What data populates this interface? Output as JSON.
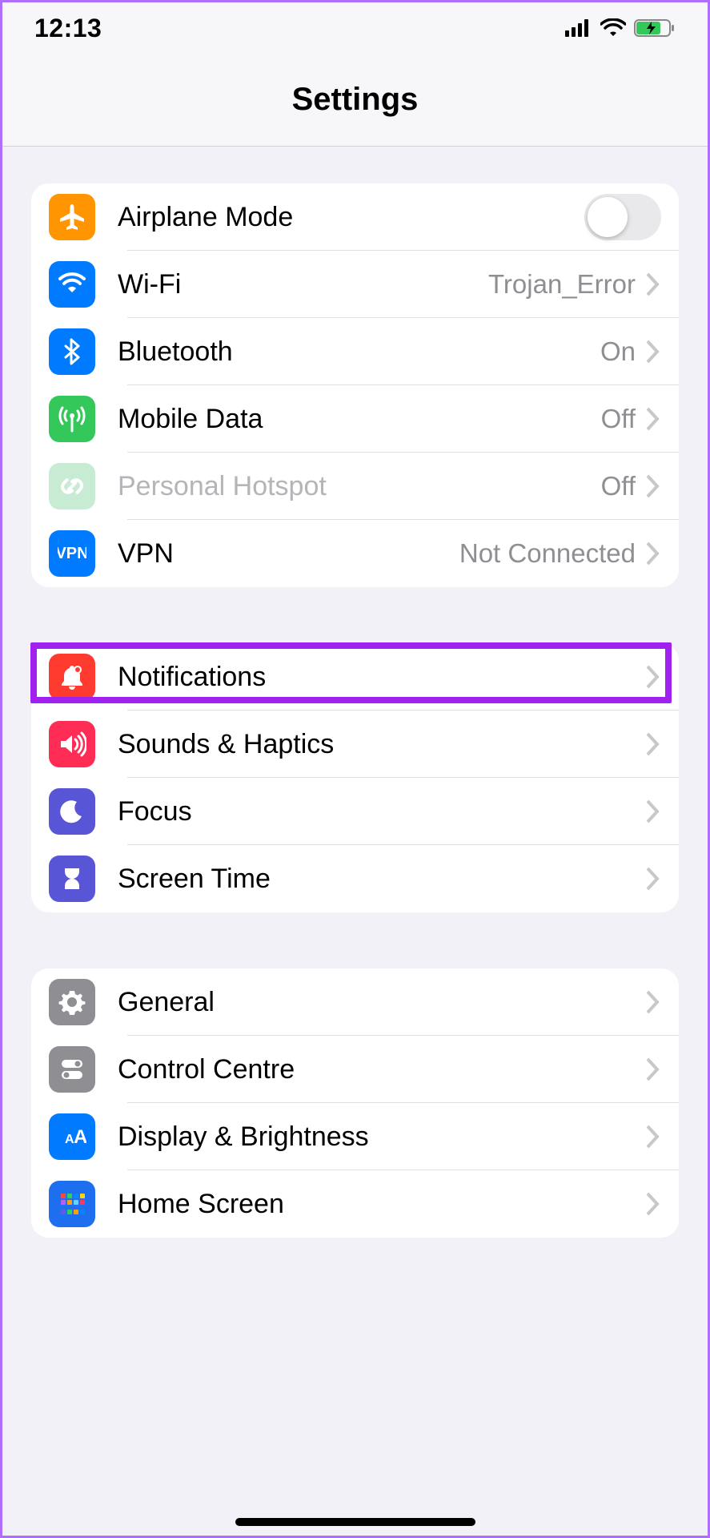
{
  "status": {
    "time": "12:13"
  },
  "header": {
    "title": "Settings"
  },
  "groups": [
    {
      "rows": [
        {
          "id": "airplane",
          "label": "Airplane Mode",
          "value": "",
          "kind": "toggle",
          "toggle_on": false,
          "icon": "airplane-icon",
          "icon_bg": "bg-orange"
        },
        {
          "id": "wifi",
          "label": "Wi-Fi",
          "value": "Trojan_Error",
          "kind": "link",
          "icon": "wifi-icon",
          "icon_bg": "bg-blue"
        },
        {
          "id": "bluetooth",
          "label": "Bluetooth",
          "value": "On",
          "kind": "link",
          "icon": "bluetooth-icon",
          "icon_bg": "bg-blue"
        },
        {
          "id": "mobile",
          "label": "Mobile Data",
          "value": "Off",
          "kind": "link",
          "icon": "antenna-icon",
          "icon_bg": "bg-green"
        },
        {
          "id": "hotspot",
          "label": "Personal Hotspot",
          "value": "Off",
          "kind": "link",
          "icon": "link-icon",
          "icon_bg": "bg-lgreen",
          "disabled": true
        },
        {
          "id": "vpn",
          "label": "VPN",
          "value": "Not Connected",
          "kind": "link",
          "icon": "vpn-icon",
          "icon_bg": "bg-blue"
        }
      ]
    },
    {
      "rows": [
        {
          "id": "notifications",
          "label": "Notifications",
          "value": "",
          "kind": "link",
          "icon": "bell-icon",
          "icon_bg": "bg-red",
          "highlighted": true
        },
        {
          "id": "sounds",
          "label": "Sounds & Haptics",
          "value": "",
          "kind": "link",
          "icon": "speaker-icon",
          "icon_bg": "bg-pink"
        },
        {
          "id": "focus",
          "label": "Focus",
          "value": "",
          "kind": "link",
          "icon": "moon-icon",
          "icon_bg": "bg-indigo"
        },
        {
          "id": "screentime",
          "label": "Screen Time",
          "value": "",
          "kind": "link",
          "icon": "hourglass-icon",
          "icon_bg": "bg-indigo"
        }
      ]
    },
    {
      "rows": [
        {
          "id": "general",
          "label": "General",
          "value": "",
          "kind": "link",
          "icon": "gear-icon",
          "icon_bg": "bg-gray"
        },
        {
          "id": "control",
          "label": "Control Centre",
          "value": "",
          "kind": "link",
          "icon": "switches-icon",
          "icon_bg": "bg-gray"
        },
        {
          "id": "display",
          "label": "Display & Brightness",
          "value": "",
          "kind": "link",
          "icon": "aa-icon",
          "icon_bg": "bg-blue"
        },
        {
          "id": "homescreen",
          "label": "Home Screen",
          "value": "",
          "kind": "link",
          "icon": "grid-icon",
          "icon_bg": "bg-dblue"
        }
      ]
    }
  ],
  "colors": {
    "highlight": "#a020f0"
  }
}
